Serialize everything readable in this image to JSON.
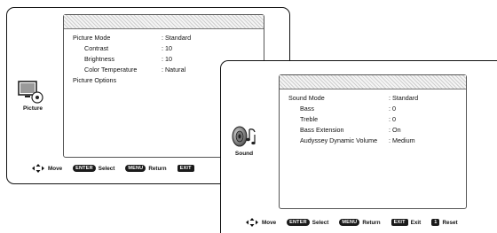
{
  "picture_screen": {
    "category_label": "Picture",
    "items": [
      {
        "label": "Picture Mode",
        "value": ": Standard",
        "sub": false
      },
      {
        "label": "Contrast",
        "value": ": 10",
        "sub": true
      },
      {
        "label": "Brightness",
        "value": ": 10",
        "sub": true
      },
      {
        "label": "Color Temperature",
        "value": ": Natural",
        "sub": true
      },
      {
        "label": "Picture Options",
        "value": "",
        "sub": false
      }
    ],
    "navbar": {
      "move": "Move",
      "enter_key": "ENTER",
      "select": "Select",
      "menu_key": "MENU",
      "return": "Return",
      "exit_key": "EXIT"
    }
  },
  "sound_screen": {
    "category_label": "Sound",
    "items": [
      {
        "label": "Sound Mode",
        "value": ": Standard",
        "sub": false
      },
      {
        "label": "Bass",
        "value": ": 0",
        "sub": true
      },
      {
        "label": "Treble",
        "value": ": 0",
        "sub": true
      },
      {
        "label": "Bass Extension",
        "value": ": On",
        "sub": true
      },
      {
        "label": "Audyssey Dynamic Volume",
        "value": ": Medium",
        "sub": true
      }
    ],
    "navbar": {
      "move": "Move",
      "enter_key": "ENTER",
      "select": "Select",
      "menu_key": "MENU",
      "return": "Return",
      "exit_key": "EXIT",
      "exit": "Exit",
      "reset_key": "1",
      "reset": "Reset"
    }
  },
  "icons": {
    "picture": "tv-picture-icon",
    "sound": "speaker-sound-icon",
    "navigation": "four-way-arrow-icon"
  }
}
